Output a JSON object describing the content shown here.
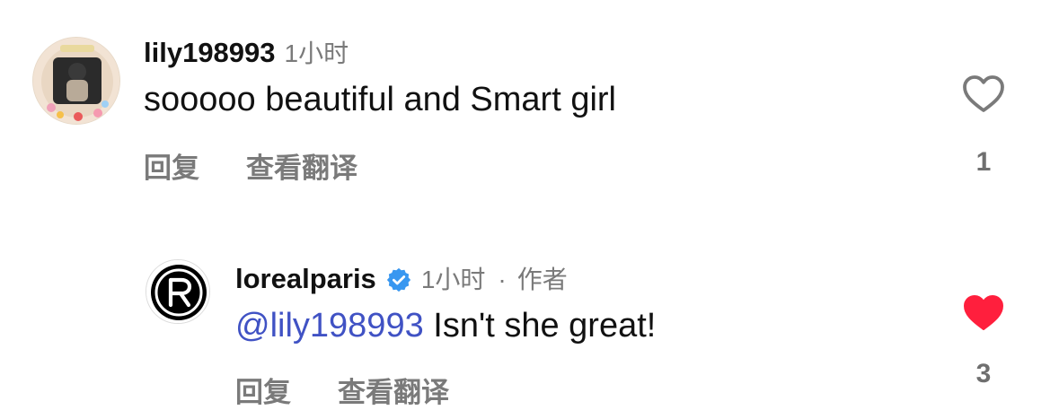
{
  "comments": [
    {
      "username": "lily198993",
      "time": "1小时",
      "text": "sooooo beautiful and Smart girl",
      "reply_label": "回复",
      "translate_label": "查看翻译",
      "likes": "1",
      "liked": false,
      "avatar_icon": "user-photo-avatar"
    },
    {
      "username": "lorealparis",
      "verified": true,
      "time": "1小时",
      "separator": "·",
      "author_label": "作者",
      "mention": "@lily198993",
      "text": " Isn't she great!",
      "reply_label": "回复",
      "translate_label": "查看翻译",
      "likes": "3",
      "liked": true,
      "avatar_icon": "brand-logo-avatar"
    }
  ],
  "colors": {
    "mention": "#4052c4",
    "verified": "#3897f0",
    "liked_heart": "#ff1f3d",
    "muted_text": "#7a7a7a"
  }
}
